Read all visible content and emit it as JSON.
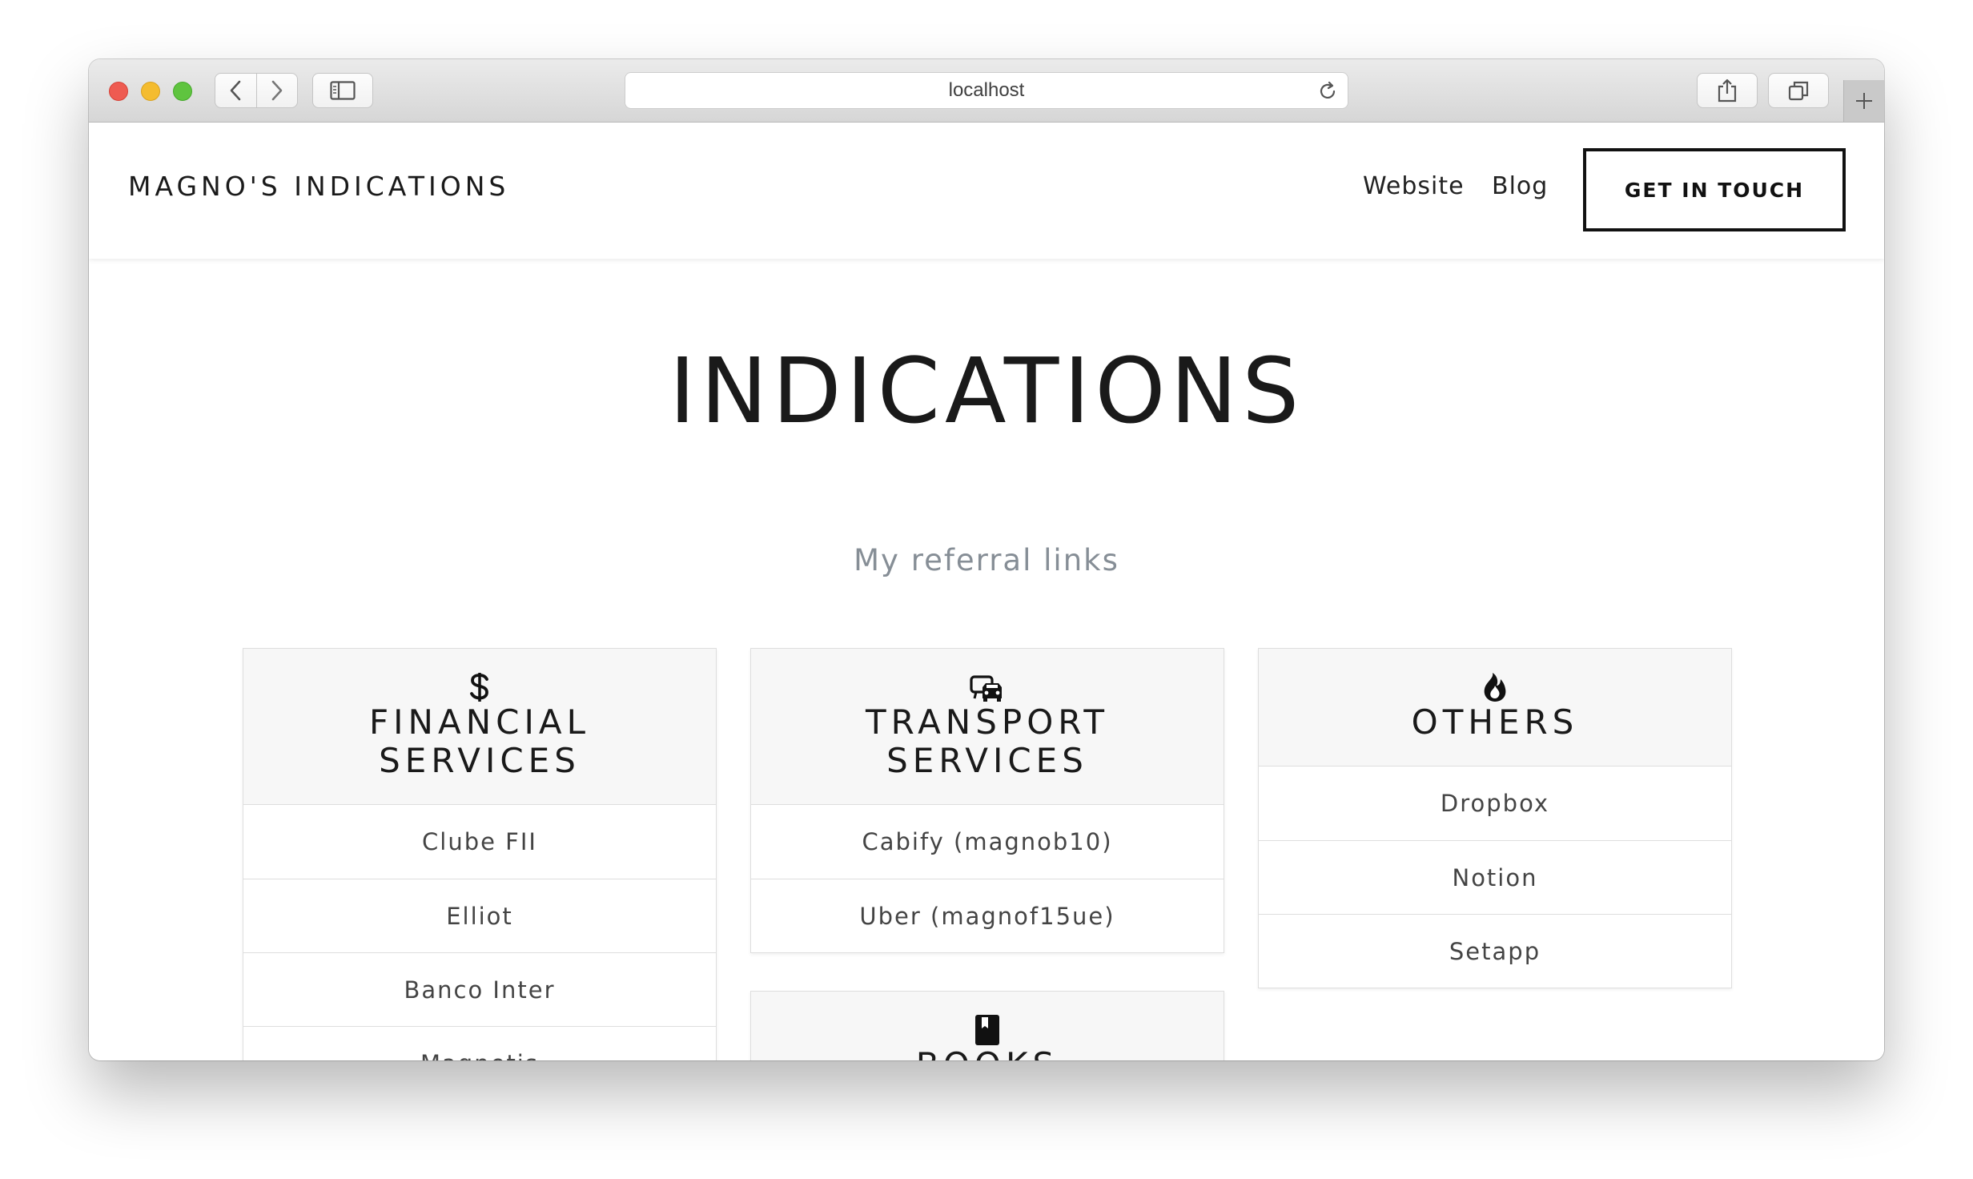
{
  "browser": {
    "url": "localhost"
  },
  "header": {
    "brand": "MAGNO'S INDICATIONS",
    "nav": {
      "website": "Website",
      "blog": "Blog"
    },
    "cta_label": "GET IN TOUCH"
  },
  "hero": {
    "title": "INDICATIONS",
    "subtitle": "My referral links"
  },
  "cards": {
    "financial": {
      "icon": "dollar-icon",
      "title_line1": "FINANCIAL",
      "title_line2": "SERVICES",
      "items": [
        "Clube FII",
        "Elliot",
        "Banco Inter",
        "Magnetis"
      ]
    },
    "transport": {
      "icon": "transport-icon",
      "title_line1": "TRANSPORT",
      "title_line2": "SERVICES",
      "items": [
        "Cabify (magnob10)",
        "Uber (magnof15ue)"
      ]
    },
    "others": {
      "icon": "fire-icon",
      "title_line1": "OTHERS",
      "items": [
        "Dropbox",
        "Notion",
        "Setapp"
      ]
    },
    "books": {
      "icon": "book-icon",
      "title_line1": "BOOKS"
    }
  },
  "colors": {
    "text": "#1a1a1a",
    "muted": "#868e96",
    "card_header_bg": "#f7f7f7",
    "border": "#dedede"
  }
}
